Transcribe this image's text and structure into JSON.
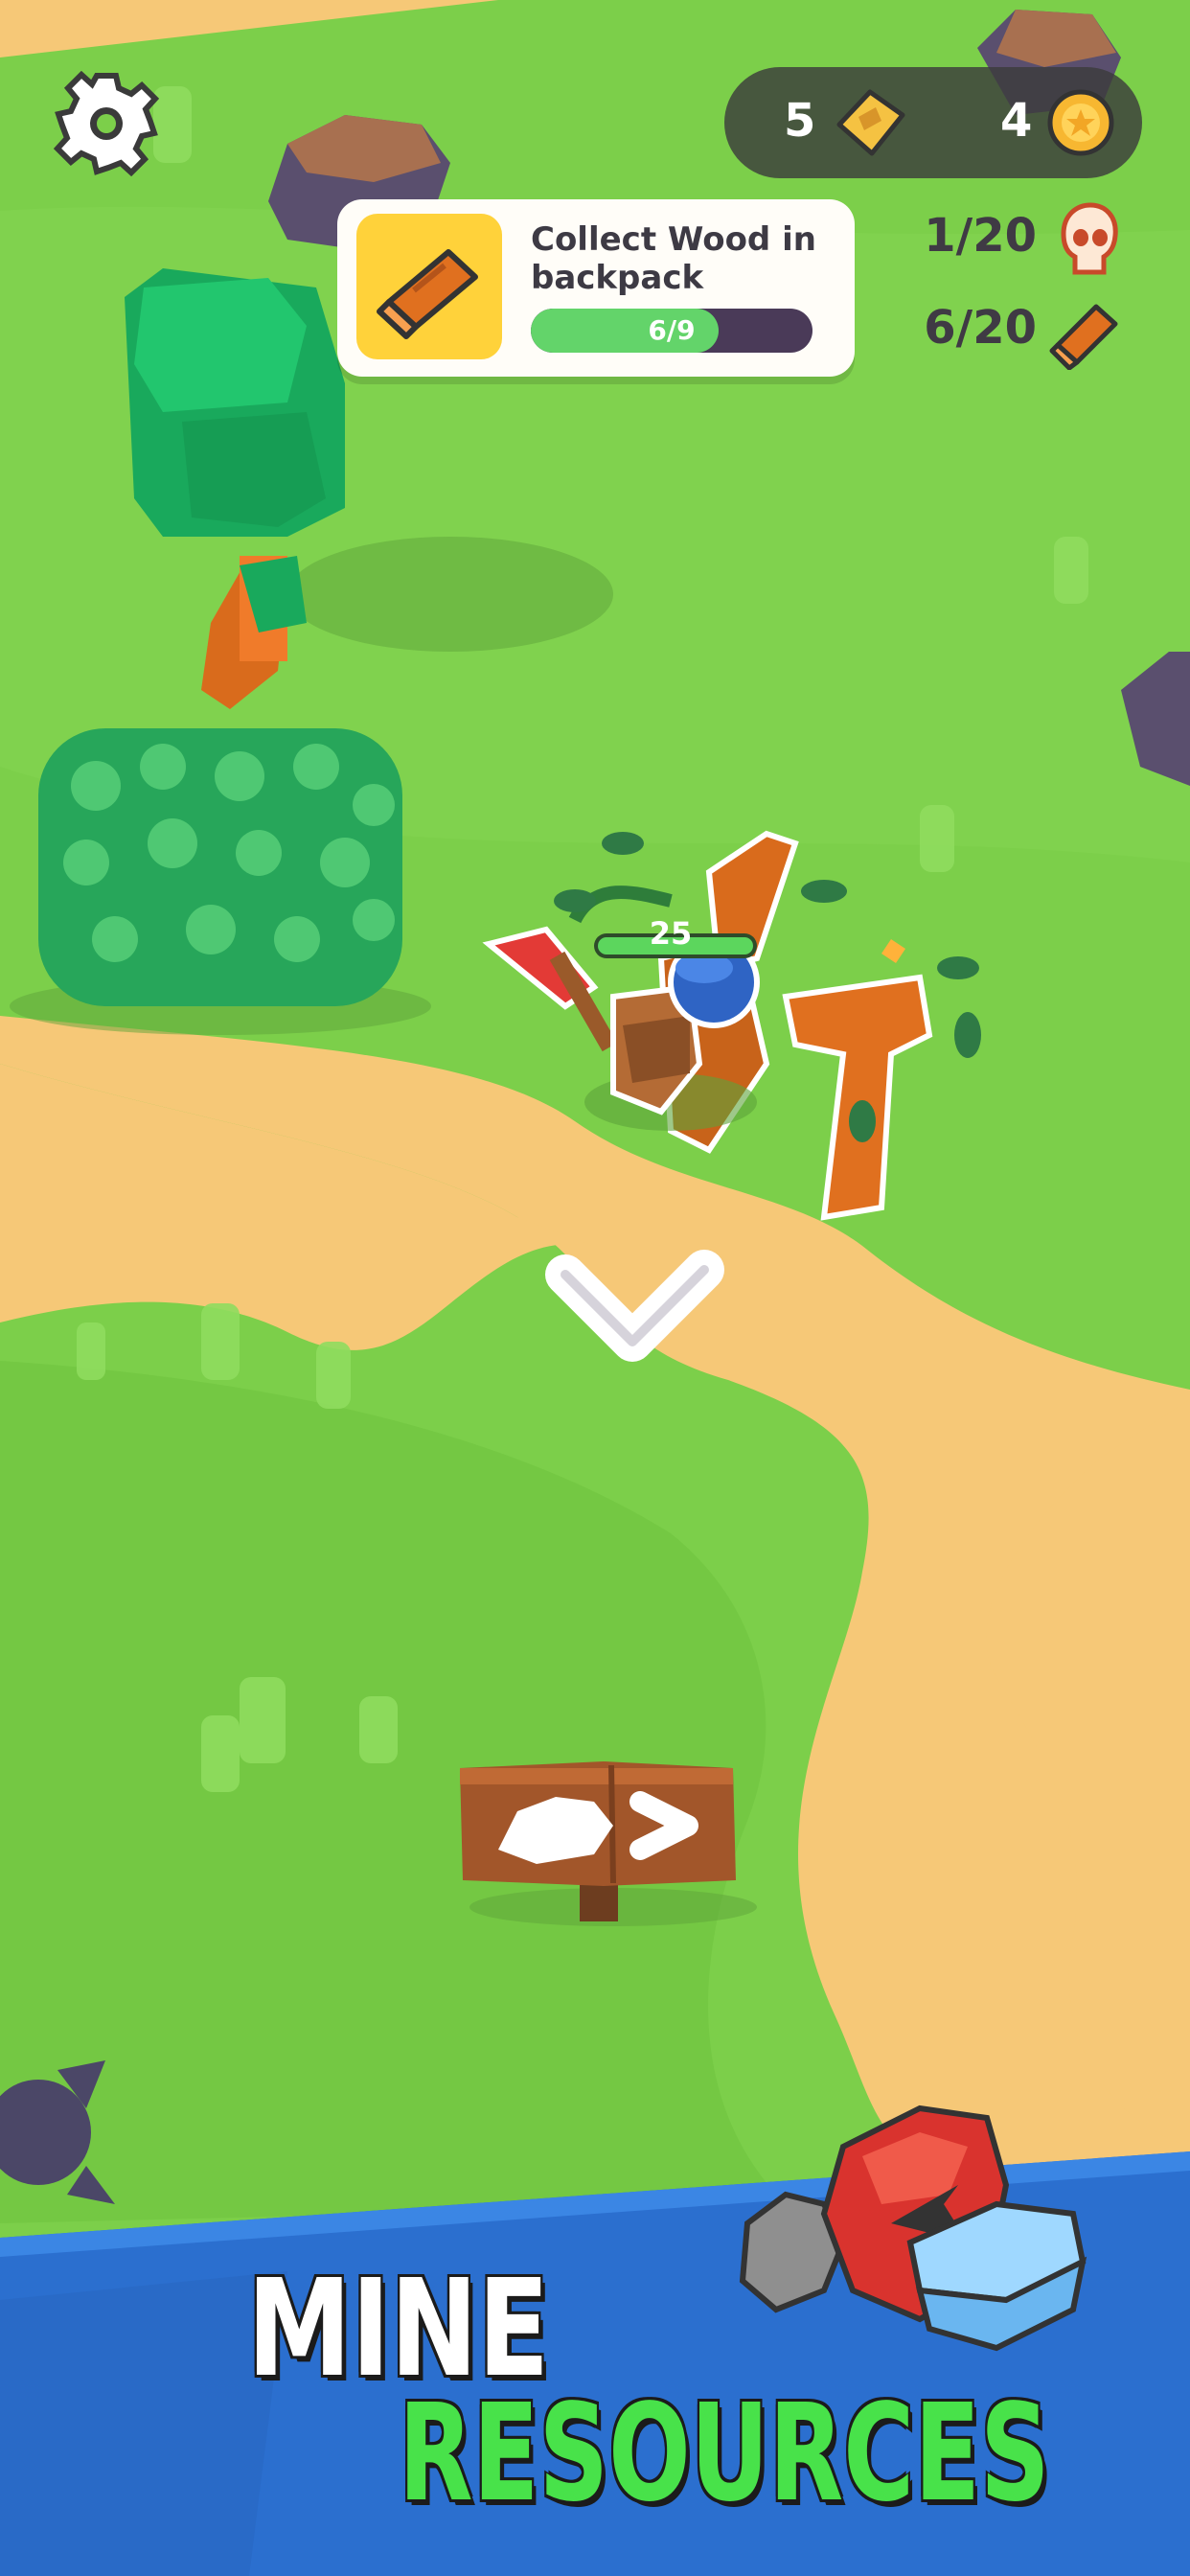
{
  "hud": {
    "tickets_count": "5",
    "coins_count": "4",
    "tickets_icon": "ticket-icon",
    "coins_icon": "coin-icon",
    "settings_icon": "gear-icon"
  },
  "quest": {
    "title": "Collect Wood in backpack",
    "progress_text": "6/9",
    "progress_fraction": 0.667,
    "icon": "wood-log-icon"
  },
  "counters": [
    {
      "value": "1/20",
      "icon": "skull-icon"
    },
    {
      "value": "6/20",
      "icon": "wood-log-icon"
    }
  ],
  "player": {
    "health": "25"
  },
  "banner": {
    "line1": "MINE",
    "line2": "RESOURCES"
  },
  "colors": {
    "grass": "#7ccf4a",
    "sand": "#f6c877",
    "banner_blue": "#2b6fcf",
    "progress_green": "#63d46a",
    "title_green": "#48e24a"
  }
}
